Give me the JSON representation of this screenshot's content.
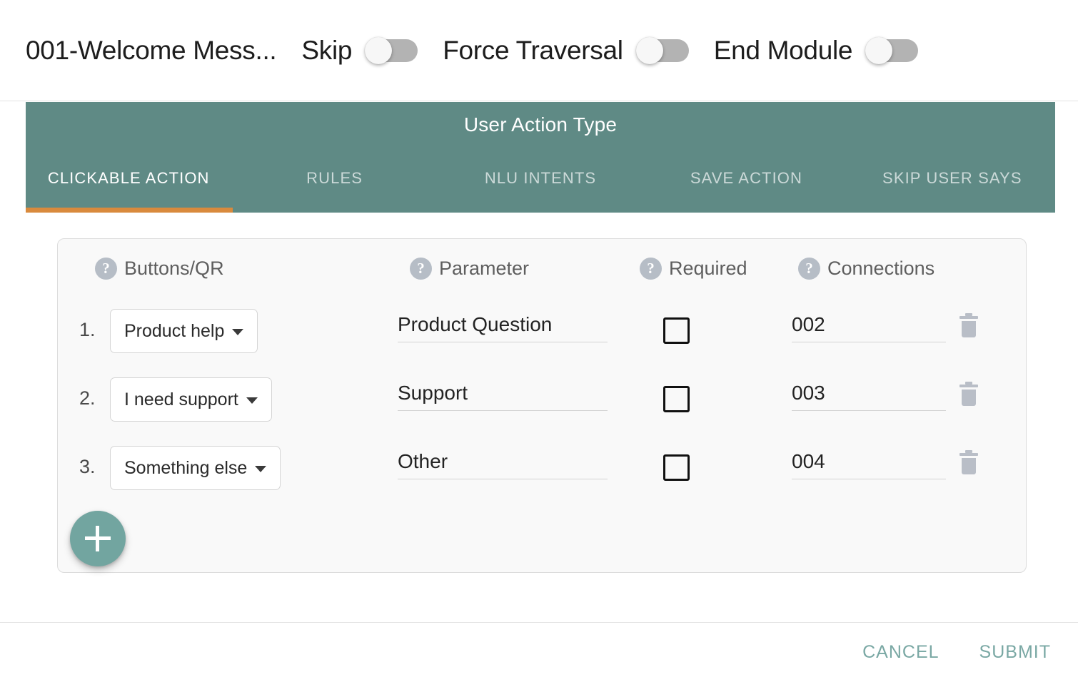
{
  "header": {
    "module_title": "001-Welcome Mess...",
    "toggles": [
      {
        "label": "Skip",
        "state": "off"
      },
      {
        "label": "Force Traversal",
        "state": "off"
      },
      {
        "label": "End Module",
        "state": "off"
      }
    ]
  },
  "action_panel": {
    "title": "User Action Type",
    "accent_color": "#5f8a85",
    "indicator_color": "#d98a3d",
    "tabs": [
      {
        "label": "CLICKABLE ACTION",
        "active": true
      },
      {
        "label": "RULES",
        "active": false
      },
      {
        "label": "NLU INTENTS",
        "active": false
      },
      {
        "label": "SAVE ACTION",
        "active": false
      },
      {
        "label": "SKIP USER SAYS",
        "active": false
      }
    ]
  },
  "table": {
    "columns": [
      {
        "label": "Buttons/QR",
        "help": "?"
      },
      {
        "label": "Parameter",
        "help": "?"
      },
      {
        "label": "Required",
        "help": "?"
      },
      {
        "label": "Connections",
        "help": "?"
      }
    ],
    "rows": [
      {
        "index": "1.",
        "button": "Product help",
        "parameter": "Product Question",
        "required": false,
        "connection": "002"
      },
      {
        "index": "2.",
        "button": "I need support",
        "parameter": "Support",
        "required": false,
        "connection": "003"
      },
      {
        "index": "3.",
        "button": "Something else",
        "parameter": "Other",
        "required": false,
        "connection": "004"
      }
    ],
    "add_button_label": "+"
  },
  "footer": {
    "cancel_label": "CANCEL",
    "submit_label": "SUBMIT",
    "button_color": "#7aa8a4"
  }
}
